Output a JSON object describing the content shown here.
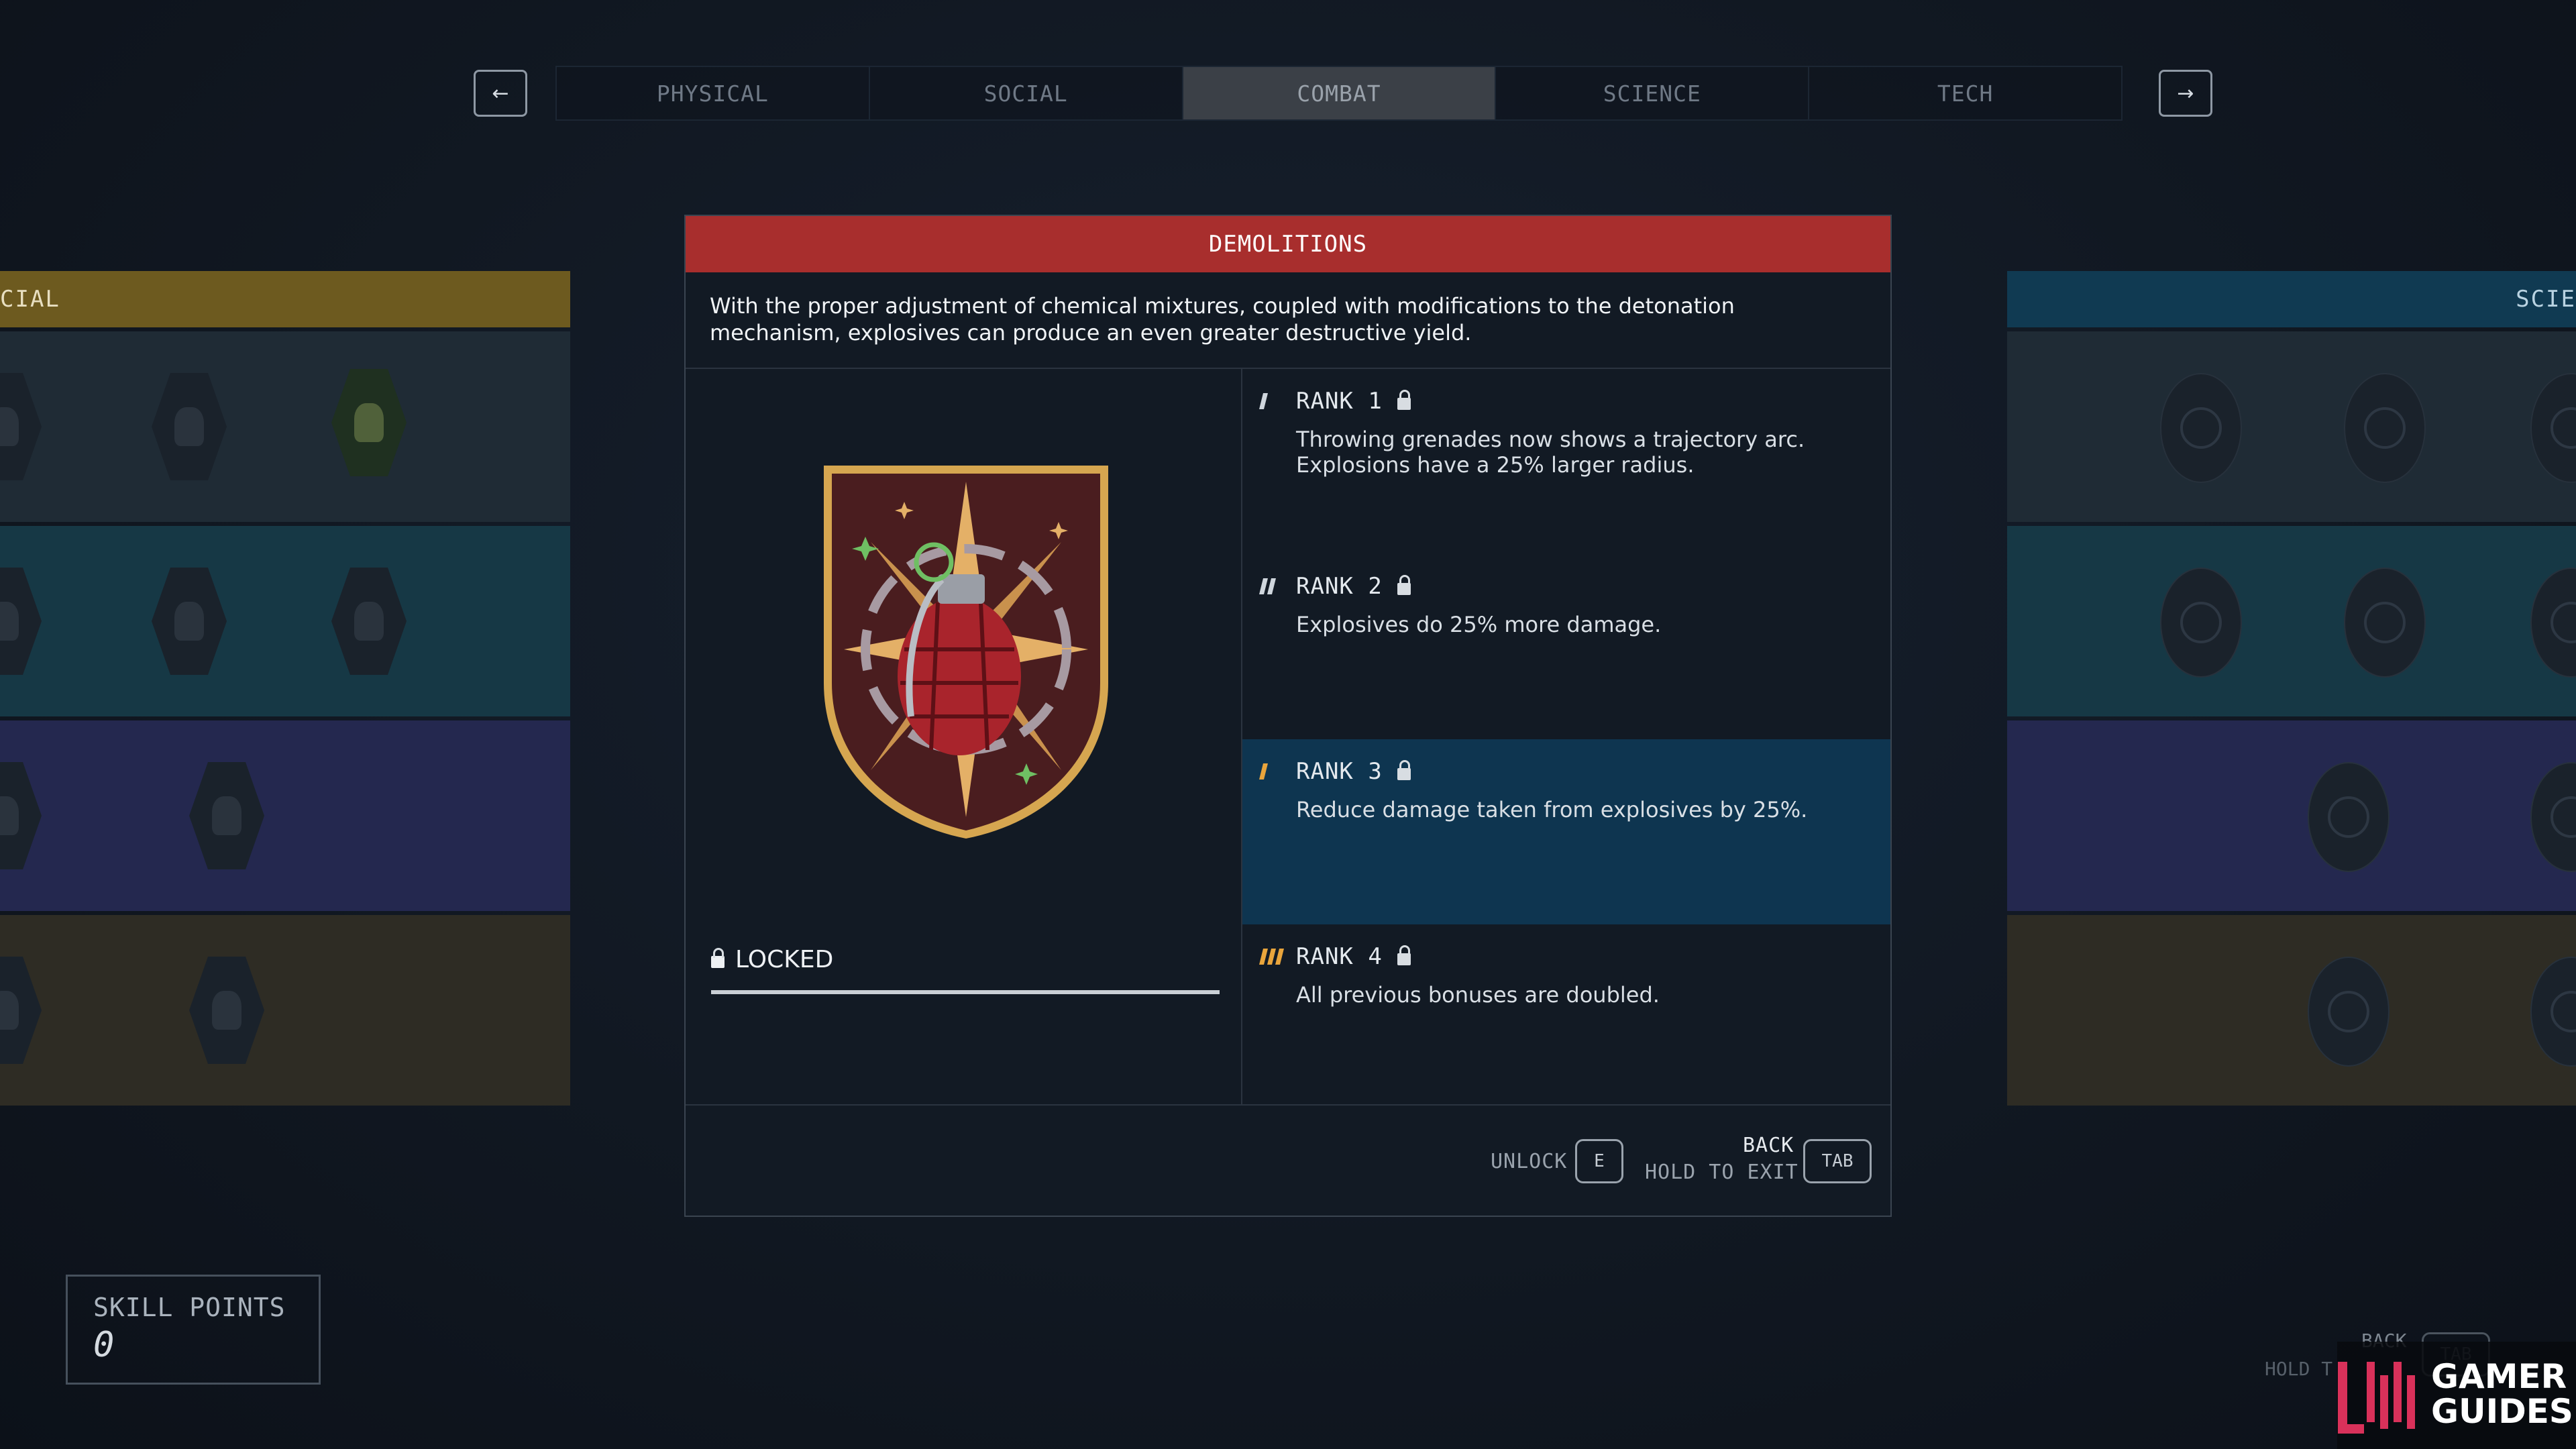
{
  "nav": {
    "prev_icon": "arrow-left-icon",
    "next_icon": "arrow-right-icon",
    "prev_glyph": "←",
    "next_glyph": "→",
    "tabs": [
      {
        "label": "PHYSICAL",
        "active": false
      },
      {
        "label": "SOCIAL",
        "active": false
      },
      {
        "label": "COMBAT",
        "active": true
      },
      {
        "label": "SCIENCE",
        "active": false
      },
      {
        "label": "TECH",
        "active": false
      }
    ]
  },
  "left_tree": {
    "header": "CIAL",
    "header_color": "#6d5a1f",
    "band_colors": [
      "#1f2b35",
      "#163845",
      "#24284f",
      "#2e2c24"
    ]
  },
  "right_tree": {
    "header": "SCIE",
    "header_color": "#103a52",
    "band_colors": [
      "#1f2b35",
      "#163845",
      "#24284f",
      "#2e2c24"
    ]
  },
  "skill": {
    "title": "DEMOLITIONS",
    "title_color": "#a82e2d",
    "description": "With the proper adjustment of chemical mixtures, coupled with modifications to the detonation mechanism, explosives can produce an even greater destructive yield.",
    "badge_icon": "grenade-patch-icon",
    "status": "LOCKED",
    "ranks": [
      {
        "label": "RANK 1",
        "text": "Throwing grenades now shows a trajectory arc. Explosions have a 25% larger radius.",
        "pips": 1,
        "selected": false
      },
      {
        "label": "RANK 2",
        "text": "Explosives do 25% more damage.",
        "pips": 2,
        "selected": false
      },
      {
        "label": "RANK 3",
        "text": "Reduce damage taken from explosives by 25%.",
        "pips": 1,
        "selected": true
      },
      {
        "label": "RANK 4",
        "text": "All previous bonuses are doubled.",
        "pips": 3,
        "selected": false
      }
    ]
  },
  "footer": {
    "unlock_label": "UNLOCK",
    "unlock_key": "E",
    "back_label": "BACK",
    "hold_label": "HOLD TO EXIT",
    "back_key": "TAB"
  },
  "skill_points": {
    "label": "SKILL POINTS",
    "value": "0"
  },
  "background_footer": {
    "back_label": "BACK",
    "hold_label": "HOLD T",
    "key": "TAB"
  },
  "watermark": {
    "line1": "GAMER",
    "line2": "GUIDES"
  }
}
